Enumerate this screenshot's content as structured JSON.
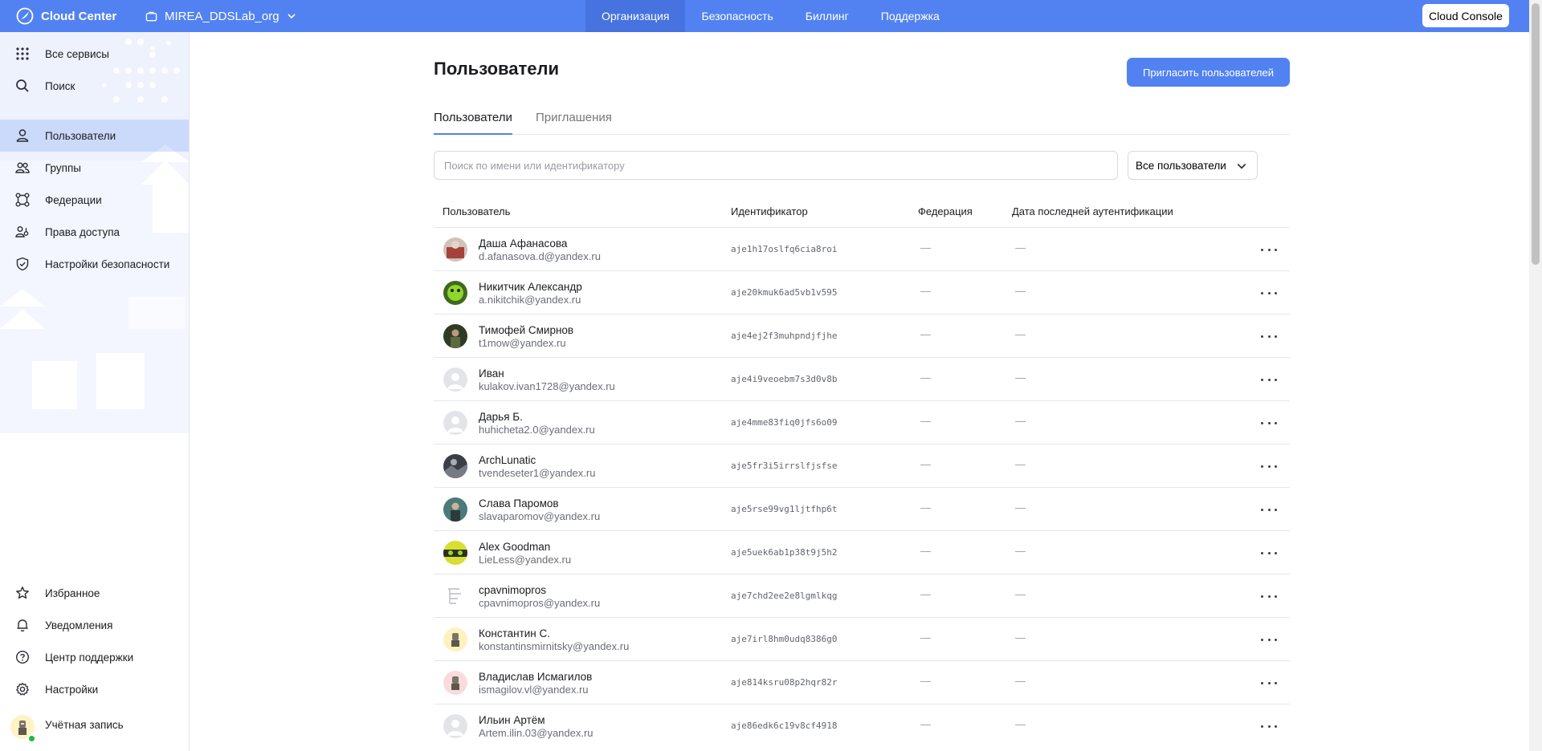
{
  "topbar": {
    "brand": "Cloud Center",
    "org": "MIREA_DDSLab_org",
    "nav": [
      {
        "label": "Организация",
        "active": true
      },
      {
        "label": "Безопасность",
        "active": false
      },
      {
        "label": "Биллинг",
        "active": false
      },
      {
        "label": "Поддержка",
        "active": false
      }
    ],
    "console_button": "Cloud Console"
  },
  "sidebar": {
    "top_items": [
      {
        "label": "Все сервисы",
        "icon": "apps-grid-icon"
      },
      {
        "label": "Поиск",
        "icon": "search-icon"
      }
    ],
    "section_items": [
      {
        "label": "Пользователи",
        "icon": "person-icon",
        "active": true
      },
      {
        "label": "Группы",
        "icon": "group-icon",
        "active": false
      },
      {
        "label": "Федерации",
        "icon": "federation-icon",
        "active": false
      },
      {
        "label": "Права доступа",
        "icon": "access-rights-icon",
        "active": false
      },
      {
        "label": "Настройки безопасности",
        "icon": "shield-icon",
        "active": false
      }
    ],
    "bottom_items": [
      {
        "label": "Избранное",
        "icon": "star-icon"
      },
      {
        "label": "Уведомления",
        "icon": "bell-icon"
      },
      {
        "label": "Центр поддержки",
        "icon": "help-icon"
      },
      {
        "label": "Настройки",
        "icon": "gear-icon"
      },
      {
        "label": "Учётная запись",
        "icon": "account-avatar"
      }
    ]
  },
  "main": {
    "title": "Пользователи",
    "invite_button": "Пригласить пользователей",
    "tabs": [
      {
        "label": "Пользователи",
        "active": true
      },
      {
        "label": "Приглашения",
        "active": false
      }
    ],
    "search_placeholder": "Поиск по имени или идентификатору",
    "filter_value": "Все пользователи",
    "columns": [
      "Пользователь",
      "Идентификатор",
      "Федерация",
      "Дата последней аутентификации"
    ],
    "users": [
      {
        "name": "Даша Афанасова",
        "email": "d.afanasova.d@yandex.ru",
        "id": "aje1h17oslfq6cia8roi",
        "federation": "—",
        "last_auth": "—",
        "avatar": "photo-red"
      },
      {
        "name": "Никитчик Александр",
        "email": "a.nikitchik@yandex.ru",
        "id": "aje20kmuk6ad5vb1v595",
        "federation": "—",
        "last_auth": "—",
        "avatar": "photo-green"
      },
      {
        "name": "Тимофей Смирнов",
        "email": "t1mow@yandex.ru",
        "id": "aje4ej2f3muhpndjfjhe",
        "federation": "—",
        "last_auth": "—",
        "avatar": "photo-forest"
      },
      {
        "name": "Иван",
        "email": "kulakov.ivan1728@yandex.ru",
        "id": "aje4i9veoebm7s3d0v8b",
        "federation": "—",
        "last_auth": "—",
        "avatar": "default"
      },
      {
        "name": "Дарья Б.",
        "email": "huhicheta2.0@yandex.ru",
        "id": "aje4mme83fiq0jfs6o09",
        "federation": "—",
        "last_auth": "—",
        "avatar": "default"
      },
      {
        "name": "ArchLunatic",
        "email": "tvendeseter1@yandex.ru",
        "id": "aje5fr3i5irrslfjsfse",
        "federation": "—",
        "last_auth": "—",
        "avatar": "photo-dark"
      },
      {
        "name": "Слава Паромов",
        "email": "slavaparomov@yandex.ru",
        "id": "aje5rse99vg1ljtfhp6t",
        "federation": "—",
        "last_auth": "—",
        "avatar": "photo-teal"
      },
      {
        "name": "Alex Goodman",
        "email": "LieLess@yandex.ru",
        "id": "aje5uek6ab1p38t9j5h2",
        "federation": "—",
        "last_auth": "—",
        "avatar": "photo-lime"
      },
      {
        "name": "cpavnimopros",
        "email": "cpavnimopros@yandex.ru",
        "id": "aje7chd2ee2e8lgmlkqg",
        "federation": "—",
        "last_auth": "—",
        "avatar": "sketch"
      },
      {
        "name": "Константин С.",
        "email": "konstantinsmirnitsky@yandex.ru",
        "id": "aje7irl8hm0udq8386g0",
        "federation": "—",
        "last_auth": "—",
        "avatar": "yellow"
      },
      {
        "name": "Владислав Исмагилов",
        "email": "ismagilov.vl@yandex.ru",
        "id": "aje814ksru08p2hqr82r",
        "federation": "—",
        "last_auth": "—",
        "avatar": "pink"
      },
      {
        "name": "Ильин Артём",
        "email": "Artem.ilin.03@yandex.ru",
        "id": "aje86edk6c19v8cf4918",
        "federation": "—",
        "last_auth": "—",
        "avatar": "default"
      }
    ]
  }
}
